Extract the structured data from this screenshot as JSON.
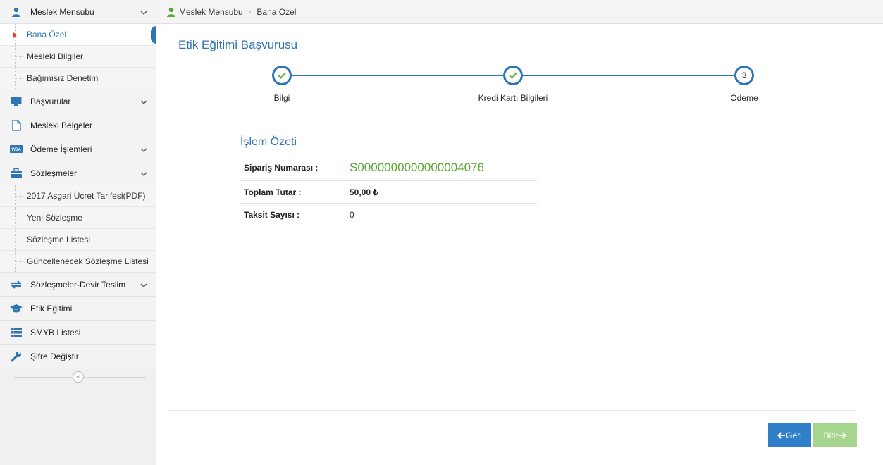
{
  "sidebar": {
    "header": {
      "label": "Meslek Mensubu",
      "icon": "user-icon"
    },
    "items": [
      {
        "label": "Bana Özel",
        "active": true
      },
      {
        "label": "Mesleki Bilgiler"
      },
      {
        "label": "Bağımısız Denetim"
      },
      {
        "label": "Başvurular",
        "icon": "monitor-icon",
        "expandable": true
      },
      {
        "label": "Mesleki Belgeler",
        "icon": "file-icon"
      },
      {
        "label": "Ödeme İşlemleri",
        "icon": "visa-icon",
        "expandable": true
      },
      {
        "label": "Sözleşmeler",
        "icon": "briefcase-icon",
        "expandable": true
      },
      {
        "label": "2017 Asgari Ücret Tarifesi(PDF)"
      },
      {
        "label": "Yeni Sözleşme"
      },
      {
        "label": "Sözleşme Listesi"
      },
      {
        "label": "Güncellenecek Sözleşme Listesi"
      },
      {
        "label": "Sözleşmeler-Devir Teslim",
        "icon": "exchange-icon",
        "expandable": true
      },
      {
        "label": "Etik Eğitimi",
        "icon": "graduation-cap-icon"
      },
      {
        "label": "SMYB Listesi",
        "icon": "list-icon"
      },
      {
        "label": "Şifre Değiştir",
        "icon": "wrench-icon"
      }
    ],
    "collapse_glyph": "«",
    "visa_text": "VISA"
  },
  "breadcrumb": {
    "root": "Meslek Mensubu",
    "current": "Bana Özel",
    "separator": "›"
  },
  "page_title": "Etik Eğitimi Başvurusu",
  "wizard": {
    "steps": [
      {
        "label": "Bilgi",
        "state": "done"
      },
      {
        "label": "Kredi Kartı Bilgileri",
        "state": "done"
      },
      {
        "label": "Ödeme",
        "state": "current",
        "number": "3"
      }
    ]
  },
  "summary": {
    "title": "İşlem Özeti",
    "rows": [
      {
        "key": "Sipariş Numarası :",
        "value": "S0000000000000004076"
      },
      {
        "key": "Toplam Tutar :",
        "value": "50,00 ₺"
      },
      {
        "key": "Taksit Sayısı :",
        "value": "0"
      }
    ]
  },
  "buttons": {
    "back": "Geri",
    "finish": "Bitir"
  },
  "colors": {
    "accent": "#2f74b5",
    "success": "#5aa832",
    "check": "#72b54a",
    "finish_bg": "#a5d58e"
  }
}
